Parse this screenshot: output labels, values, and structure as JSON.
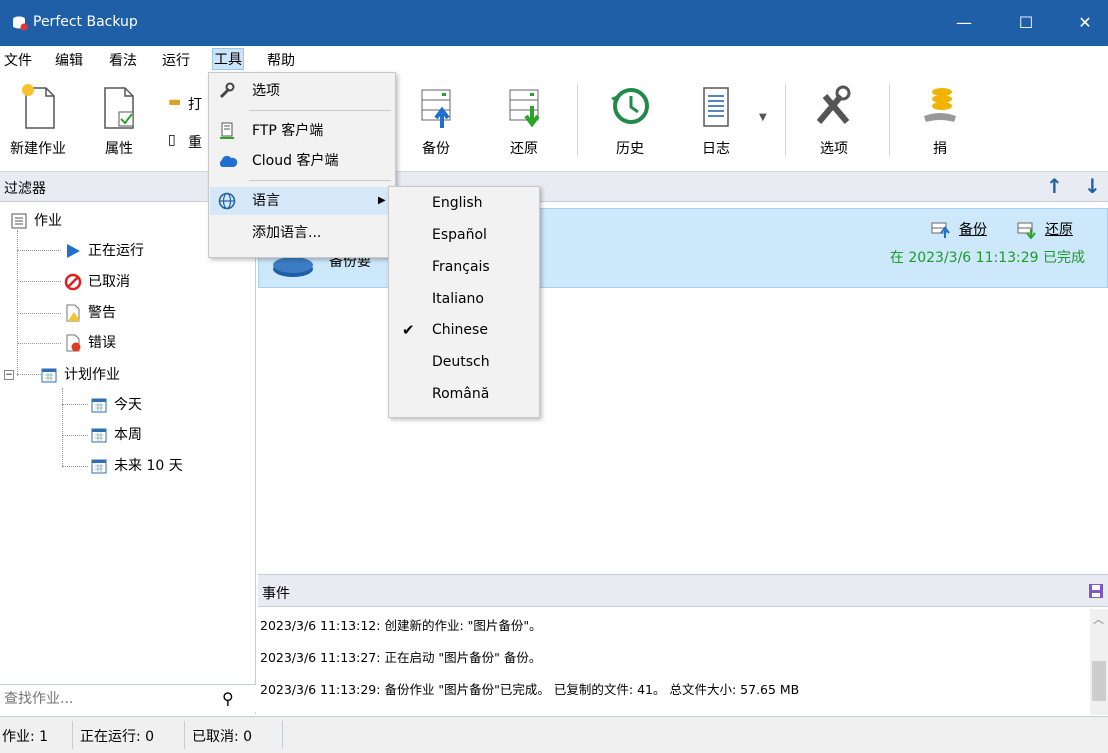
{
  "window": {
    "title": "Perfect Backup",
    "minimize": "—",
    "maximize": "☐",
    "close": "✕"
  },
  "menubar": {
    "items": [
      "文件",
      "编辑",
      "看法",
      "运行",
      "工具",
      "帮助"
    ]
  },
  "toolbar": {
    "new_job": "新建作业",
    "properties": "属性",
    "open_partial": "打",
    "re_partial": "重",
    "backup": "备份",
    "restore": "还原",
    "history": "历史",
    "log": "日志",
    "options": "选项",
    "donate": "捐"
  },
  "filter": {
    "title": "过滤器"
  },
  "tree": {
    "root": "作业",
    "running": "正在运行",
    "cancelled": "已取消",
    "warning": "警告",
    "error": "错误",
    "scheduled": "计划作业",
    "today": "今天",
    "this_week": "本周",
    "next10": "未来 10 天"
  },
  "search": {
    "placeholder": "查找作业..."
  },
  "job": {
    "name_partial": "备份要",
    "backup_link": "备份",
    "restore_link": "还原",
    "status": "在 2023/3/6 11:13:29 已完成"
  },
  "events": {
    "title": "事件",
    "lines": [
      "2023/3/6 11:13:12: 创建新的作业: \"图片备份\"。",
      "2023/3/6 11:13:27: 正在启动 \"图片备份\" 备份。",
      "2023/3/6 11:13:29: 备份作业 \"图片备份\"已完成。 已复制的文件: 41。 总文件大小: 57.65 MB"
    ]
  },
  "statusbar": {
    "jobs": "作业: 1",
    "running": "正在运行: 0",
    "cancelled": "已取消: 0"
  },
  "tools_menu": {
    "options": "选项",
    "ftp_client": "FTP 客户端",
    "cloud_client": "Cloud 客户端",
    "language": "语言",
    "add_language": "添加语言..."
  },
  "language_menu": {
    "items": [
      "English",
      "Español",
      "Français",
      "Italiano",
      "Chinese",
      "Deutsch",
      "Română"
    ],
    "selected": "Chinese"
  },
  "colors": {
    "titlebar": "#1f5fa8",
    "accent": "#1f5fa8",
    "success": "#1a9d2a",
    "selection": "#cde7fb"
  }
}
